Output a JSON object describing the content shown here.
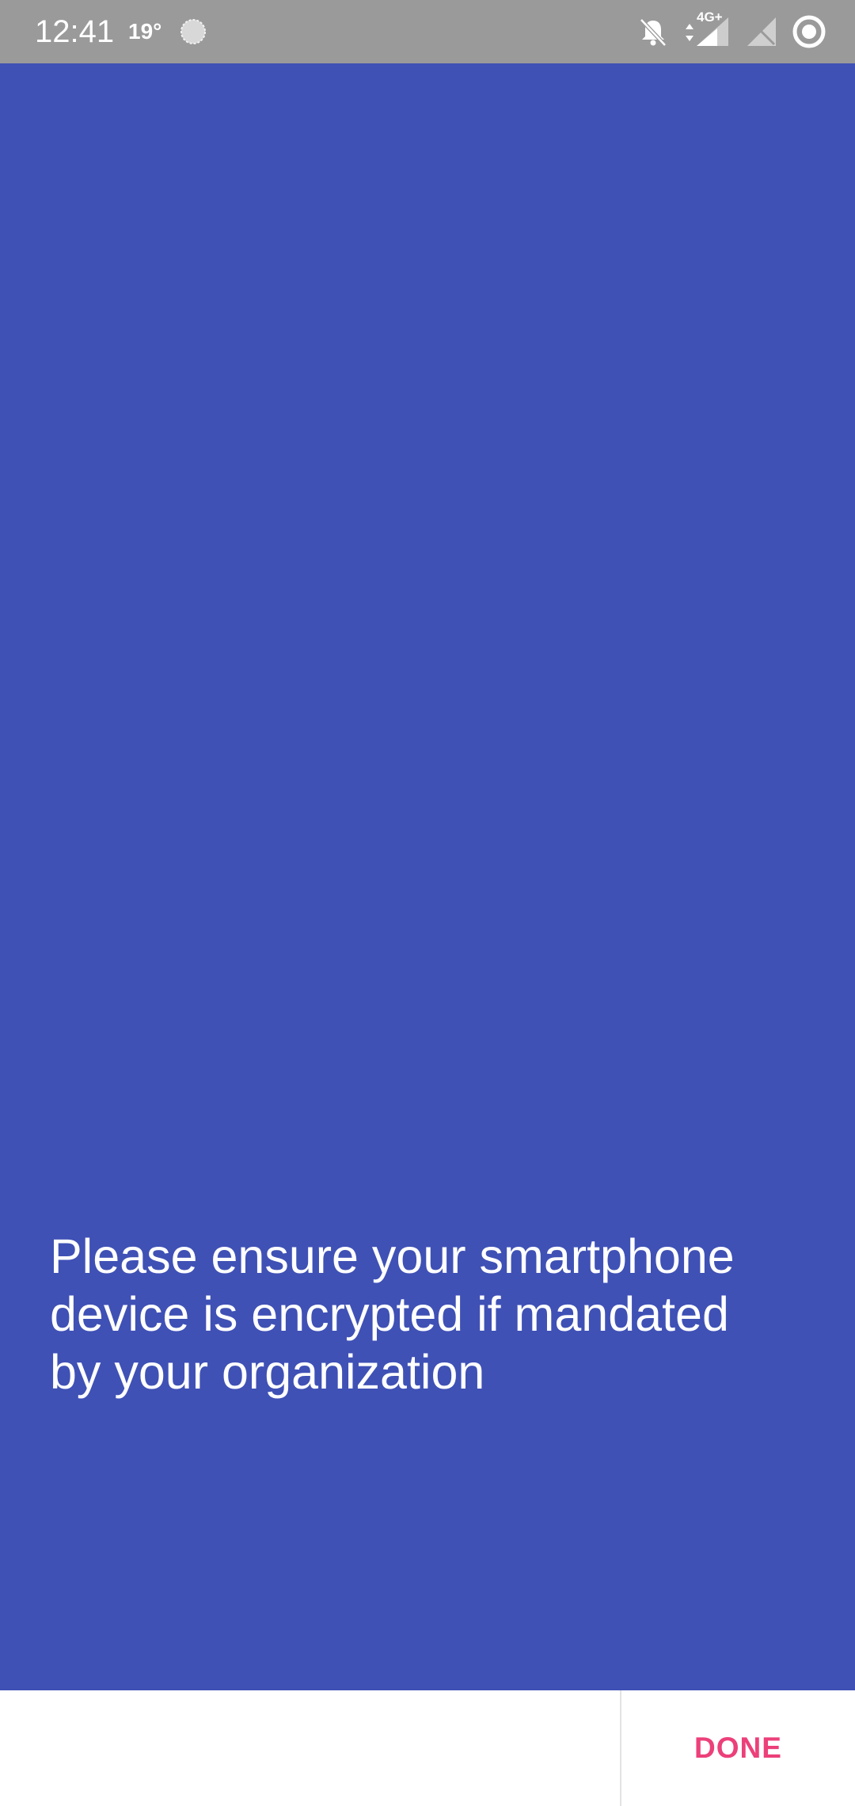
{
  "status_bar": {
    "time": "12:41",
    "temperature": "19°",
    "weather_icon": "weather-sun-icon",
    "network_label": "4G+",
    "icons": [
      "notifications-off-icon",
      "data-arrows-icon",
      "signal-icon",
      "no-sim-signal-icon",
      "record-icon"
    ]
  },
  "main": {
    "background_color": "#3f51b5",
    "message": "Please ensure your smartphone device is encrypted if mandated by your organization"
  },
  "bottom_bar": {
    "done_label": "DONE",
    "done_color": "#ec407a"
  }
}
